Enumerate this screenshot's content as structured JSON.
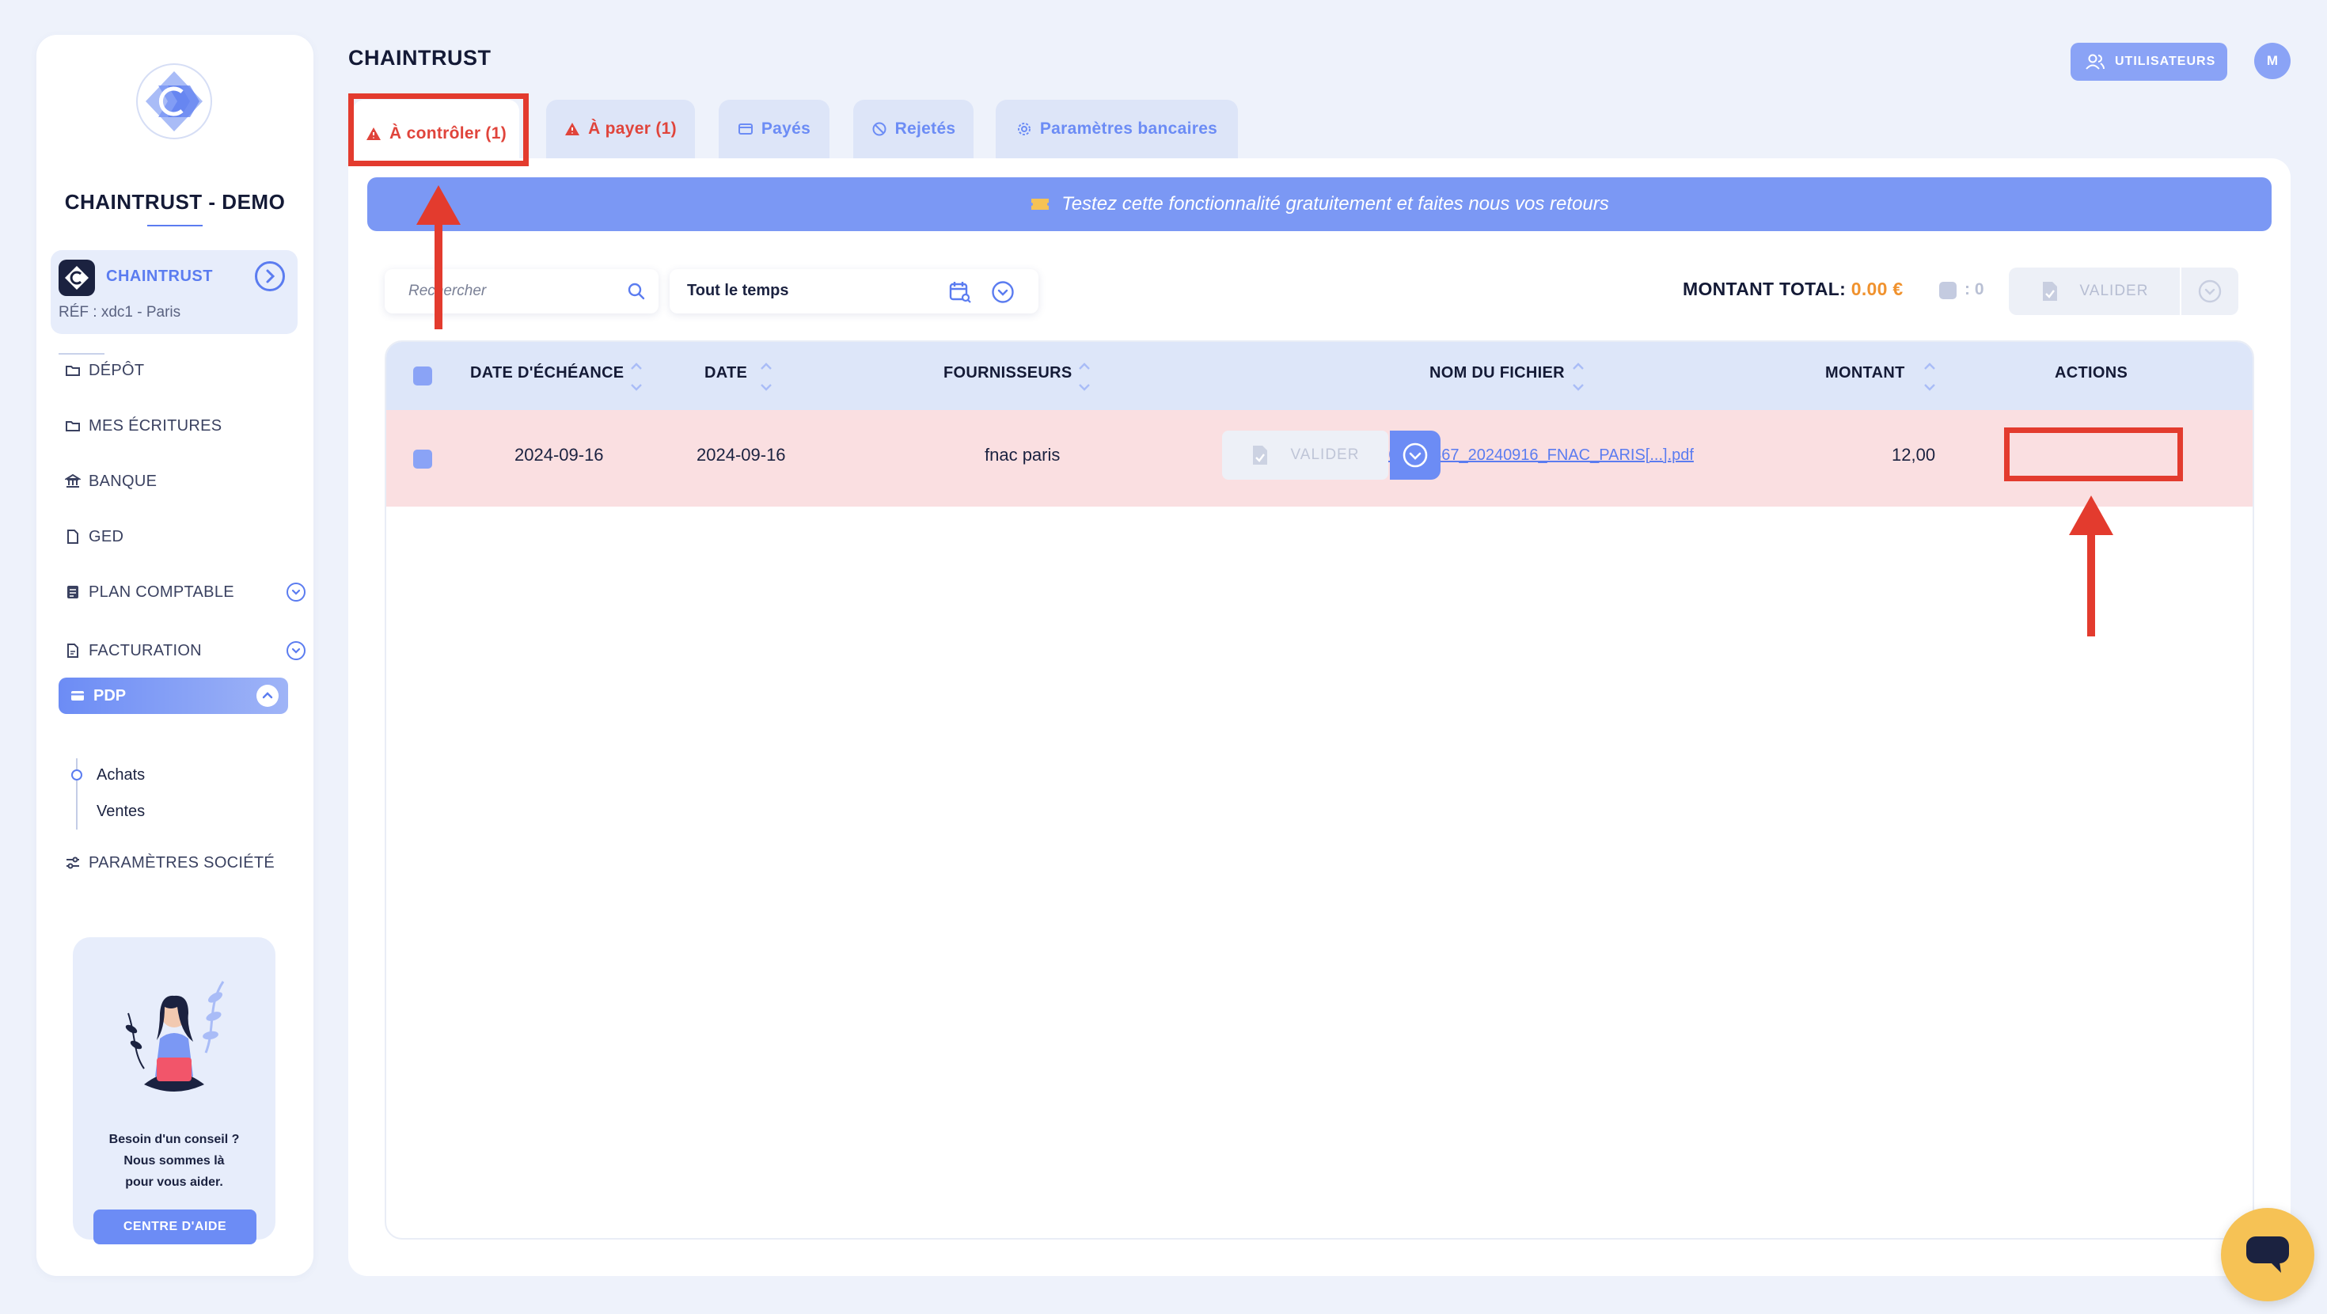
{
  "app": {
    "page_title": "CHAINTRUST"
  },
  "sidebar": {
    "company_name": "CHAINTRUST - DEMO",
    "client": {
      "name": "CHAINTRUST",
      "ref": "RÉF : xdc1 - Paris"
    },
    "nav": [
      {
        "label": "DÉPÔT",
        "icon": "folder-icon"
      },
      {
        "label": "MES ÉCRITURES",
        "icon": "folder-icon"
      },
      {
        "label": "BANQUE",
        "icon": "bank-icon"
      },
      {
        "label": "GED",
        "icon": "document-icon"
      },
      {
        "label": "PLAN COMPTABLE",
        "icon": "ledger-icon"
      },
      {
        "label": "FACTURATION",
        "icon": "invoice-icon"
      }
    ],
    "pdp": {
      "label": "PDP",
      "sub_items": [
        "Achats",
        "Ventes"
      ]
    },
    "settings_label": "PARAMÈTRES SOCIÉTÉ",
    "help": {
      "line1": "Besoin d'un conseil ?",
      "line2": "Nous sommes là",
      "line3": "pour vous aider.",
      "button": "CENTRE D'AIDE"
    }
  },
  "header": {
    "users_button": "UTILISATEURS",
    "avatar_initial": "M"
  },
  "tabs": [
    {
      "label": "À contrôler (1)",
      "tone": "red"
    },
    {
      "label": "À payer (1)",
      "tone": "red"
    },
    {
      "label": "Payés",
      "tone": "blue"
    },
    {
      "label": "Rejetés",
      "tone": "blue"
    },
    {
      "label": "Paramètres bancaires",
      "tone": "blue"
    }
  ],
  "banner": {
    "text": "Testez cette fonctionnalité gratuitement et faites nous vos retours"
  },
  "filters": {
    "search_placeholder": "Rechercher",
    "period": "Tout le temps"
  },
  "totals": {
    "label": "MONTANT TOTAL:",
    "value": "0.00 €",
    "selected_count": ": 0",
    "validate_button": "VALIDER"
  },
  "table": {
    "columns": [
      "DATE D'ÉCHÉANCE",
      "DATE",
      "FOURNISSEURS",
      "NOM DU FICHIER",
      "MONTANT",
      "ACTIONS"
    ],
    "rows": [
      {
        "due_date": "2024-09-16",
        "date": "2024-09-16",
        "supplier": "fnac paris",
        "file_name": "B000000367_20240916_FNAC_PARIS[...].pdf",
        "amount": "12,00",
        "action": "VALIDER"
      }
    ]
  },
  "colors": {
    "accent": "#6c8cf5",
    "alert_red": "#e0443b",
    "highlight_red": "#e33b2e",
    "row_highlight": "#fadfe1",
    "total_orange": "#f0922e"
  }
}
